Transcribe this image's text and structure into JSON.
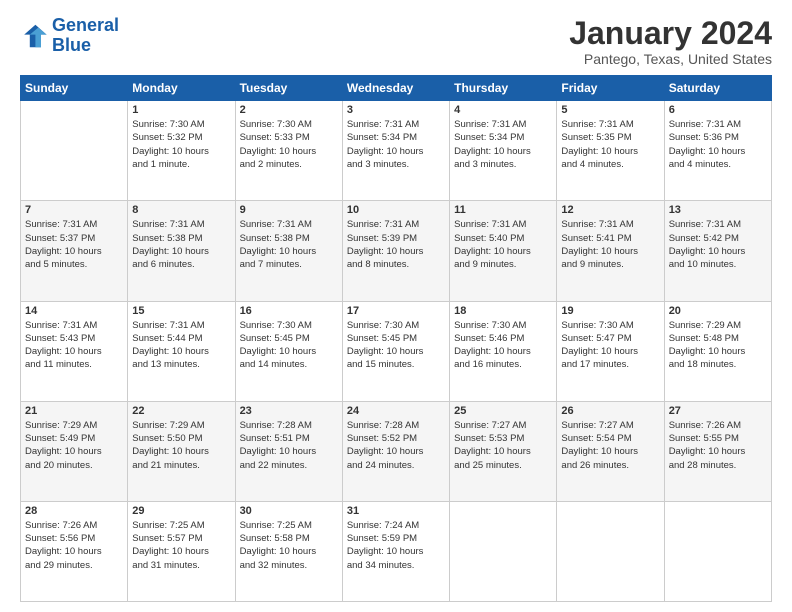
{
  "logo": {
    "line1": "General",
    "line2": "Blue"
  },
  "title": "January 2024",
  "subtitle": "Pantego, Texas, United States",
  "headers": [
    "Sunday",
    "Monday",
    "Tuesday",
    "Wednesday",
    "Thursday",
    "Friday",
    "Saturday"
  ],
  "weeks": [
    [
      {
        "day": "",
        "info": ""
      },
      {
        "day": "1",
        "info": "Sunrise: 7:30 AM\nSunset: 5:32 PM\nDaylight: 10 hours\nand 1 minute."
      },
      {
        "day": "2",
        "info": "Sunrise: 7:30 AM\nSunset: 5:33 PM\nDaylight: 10 hours\nand 2 minutes."
      },
      {
        "day": "3",
        "info": "Sunrise: 7:31 AM\nSunset: 5:34 PM\nDaylight: 10 hours\nand 3 minutes."
      },
      {
        "day": "4",
        "info": "Sunrise: 7:31 AM\nSunset: 5:34 PM\nDaylight: 10 hours\nand 3 minutes."
      },
      {
        "day": "5",
        "info": "Sunrise: 7:31 AM\nSunset: 5:35 PM\nDaylight: 10 hours\nand 4 minutes."
      },
      {
        "day": "6",
        "info": "Sunrise: 7:31 AM\nSunset: 5:36 PM\nDaylight: 10 hours\nand 4 minutes."
      }
    ],
    [
      {
        "day": "7",
        "info": "Sunrise: 7:31 AM\nSunset: 5:37 PM\nDaylight: 10 hours\nand 5 minutes."
      },
      {
        "day": "8",
        "info": "Sunrise: 7:31 AM\nSunset: 5:38 PM\nDaylight: 10 hours\nand 6 minutes."
      },
      {
        "day": "9",
        "info": "Sunrise: 7:31 AM\nSunset: 5:38 PM\nDaylight: 10 hours\nand 7 minutes."
      },
      {
        "day": "10",
        "info": "Sunrise: 7:31 AM\nSunset: 5:39 PM\nDaylight: 10 hours\nand 8 minutes."
      },
      {
        "day": "11",
        "info": "Sunrise: 7:31 AM\nSunset: 5:40 PM\nDaylight: 10 hours\nand 9 minutes."
      },
      {
        "day": "12",
        "info": "Sunrise: 7:31 AM\nSunset: 5:41 PM\nDaylight: 10 hours\nand 9 minutes."
      },
      {
        "day": "13",
        "info": "Sunrise: 7:31 AM\nSunset: 5:42 PM\nDaylight: 10 hours\nand 10 minutes."
      }
    ],
    [
      {
        "day": "14",
        "info": "Sunrise: 7:31 AM\nSunset: 5:43 PM\nDaylight: 10 hours\nand 11 minutes."
      },
      {
        "day": "15",
        "info": "Sunrise: 7:31 AM\nSunset: 5:44 PM\nDaylight: 10 hours\nand 13 minutes."
      },
      {
        "day": "16",
        "info": "Sunrise: 7:30 AM\nSunset: 5:45 PM\nDaylight: 10 hours\nand 14 minutes."
      },
      {
        "day": "17",
        "info": "Sunrise: 7:30 AM\nSunset: 5:45 PM\nDaylight: 10 hours\nand 15 minutes."
      },
      {
        "day": "18",
        "info": "Sunrise: 7:30 AM\nSunset: 5:46 PM\nDaylight: 10 hours\nand 16 minutes."
      },
      {
        "day": "19",
        "info": "Sunrise: 7:30 AM\nSunset: 5:47 PM\nDaylight: 10 hours\nand 17 minutes."
      },
      {
        "day": "20",
        "info": "Sunrise: 7:29 AM\nSunset: 5:48 PM\nDaylight: 10 hours\nand 18 minutes."
      }
    ],
    [
      {
        "day": "21",
        "info": "Sunrise: 7:29 AM\nSunset: 5:49 PM\nDaylight: 10 hours\nand 20 minutes."
      },
      {
        "day": "22",
        "info": "Sunrise: 7:29 AM\nSunset: 5:50 PM\nDaylight: 10 hours\nand 21 minutes."
      },
      {
        "day": "23",
        "info": "Sunrise: 7:28 AM\nSunset: 5:51 PM\nDaylight: 10 hours\nand 22 minutes."
      },
      {
        "day": "24",
        "info": "Sunrise: 7:28 AM\nSunset: 5:52 PM\nDaylight: 10 hours\nand 24 minutes."
      },
      {
        "day": "25",
        "info": "Sunrise: 7:27 AM\nSunset: 5:53 PM\nDaylight: 10 hours\nand 25 minutes."
      },
      {
        "day": "26",
        "info": "Sunrise: 7:27 AM\nSunset: 5:54 PM\nDaylight: 10 hours\nand 26 minutes."
      },
      {
        "day": "27",
        "info": "Sunrise: 7:26 AM\nSunset: 5:55 PM\nDaylight: 10 hours\nand 28 minutes."
      }
    ],
    [
      {
        "day": "28",
        "info": "Sunrise: 7:26 AM\nSunset: 5:56 PM\nDaylight: 10 hours\nand 29 minutes."
      },
      {
        "day": "29",
        "info": "Sunrise: 7:25 AM\nSunset: 5:57 PM\nDaylight: 10 hours\nand 31 minutes."
      },
      {
        "day": "30",
        "info": "Sunrise: 7:25 AM\nSunset: 5:58 PM\nDaylight: 10 hours\nand 32 minutes."
      },
      {
        "day": "31",
        "info": "Sunrise: 7:24 AM\nSunset: 5:59 PM\nDaylight: 10 hours\nand 34 minutes."
      },
      {
        "day": "",
        "info": ""
      },
      {
        "day": "",
        "info": ""
      },
      {
        "day": "",
        "info": ""
      }
    ]
  ]
}
